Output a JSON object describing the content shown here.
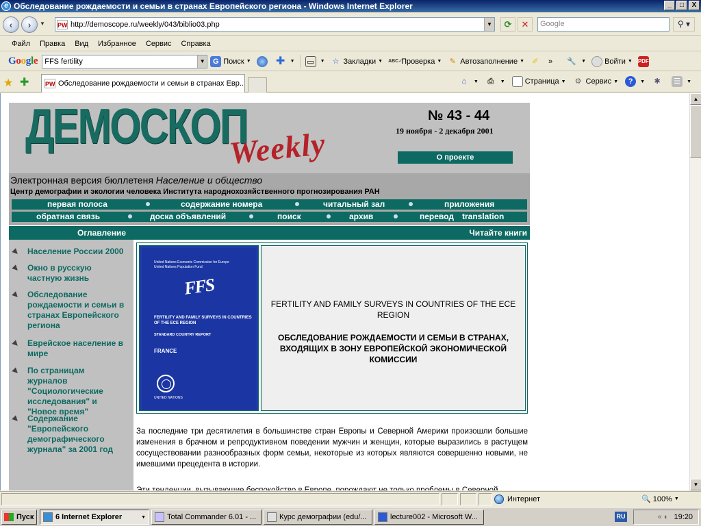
{
  "window": {
    "title": "Обследование рождаемости и семьи в странах Европейского региона - Windows Internet Explorer",
    "minimize": "_",
    "maximize": "□",
    "close": "X"
  },
  "address_bar": {
    "url": "http://demoscope.ru/weekly/043/biblio03.php",
    "search_placeholder": "Google"
  },
  "menu": [
    "Файл",
    "Правка",
    "Вид",
    "Избранное",
    "Сервис",
    "Справка"
  ],
  "google_toolbar": {
    "query": "FFS fertility",
    "search_label": "Поиск",
    "bookmarks_label": "Закладки",
    "check_label": "Проверка",
    "autofill_label": "Автозаполнение",
    "more": "»",
    "signin_label": "Войти"
  },
  "tabs": {
    "active_tab_title": "Обследование рождаемости и семьи в странах Евр..."
  },
  "command_bar": {
    "page_label": "Страница",
    "tools_label": "Сервис"
  },
  "page": {
    "logo_main": "ДЕМОСКОП",
    "logo_weekly": "Weekly",
    "issue_number": "№ 43 - 44",
    "issue_date": "19 ноября - 2 декабря 2001",
    "about_button": "О проекте",
    "subtitle_plain": "Электронная версия бюллетеня ",
    "subtitle_italic": "Население и общество",
    "institute": "Центр демографии и экологии человека Института народнохозяйственного прогнозирования РАН",
    "nav_row1": [
      "первая полоса",
      "содержание номера",
      "читальный зал",
      "приложения"
    ],
    "nav_row2": [
      "обратная связь",
      "доска объявлений",
      "поиск",
      "архив",
      "перевод",
      "translation"
    ],
    "contents_label": "Оглавление",
    "read_books_label": "Читайте книги",
    "sidebar_items": [
      "Население России 2000",
      "Окно в русскую частную жизнь",
      "Обследование рождаемости и семьи в странах Европейского региона",
      "Еврейское население в мире",
      "По страницам журналов \"Социологические исследования\" и \"Новое время\"",
      "Содержание \"Европейского демографического журнала\" за 2001 год"
    ],
    "book_cover": {
      "org_line1": "United Nations Economic Commission for Europe",
      "org_line2": "United Nations Population Fund",
      "logo": "FFS",
      "title": "FERTILITY AND FAMILY SURVEYS IN COUNTRIES OF THE ECE REGION",
      "series": "STANDARD COUNTRY REPORT",
      "country": "FRANCE",
      "publisher": "UNITED NATIONS"
    },
    "book_title_en": "FERTILITY AND FAMILY SURVEYS IN COUNTRIES OF THE ECE REGION",
    "book_title_ru": "ОБСЛЕДОВАНИЕ РОЖДАЕМОСТИ И СЕМЬИ В СТРАНАХ, ВХОДЯЩИХ В ЗОНУ ЕВРОПЕЙСКОЙ ЭКОНОМИЧЕСКОЙ КОМИССИИ",
    "paragraph1": "За последние три десятилетия в большинстве стран Европы и Северной Америки произошли большие изменения в брачном и репродуктивном поведении мужчин и женщин, которые выразились в растущем сосуществовании разнообразных форм семьи, некоторые из которых являются совершенно новыми, не имевшими прецедента в истории.",
    "paragraph2": "Эти тенденции, вызывающие беспокойство в Европе, порождают не только проблемы в Северной"
  },
  "status_bar": {
    "zone": "Интернет",
    "zoom": "100%"
  },
  "taskbar": {
    "start": "Пуск",
    "tasks": [
      "6 Internet Explorer",
      "Total Commander 6.01 - ...",
      "Курс демографии (edu/...",
      "lecture002 - Microsoft W..."
    ],
    "lang": "RU",
    "clock": "19:20"
  }
}
